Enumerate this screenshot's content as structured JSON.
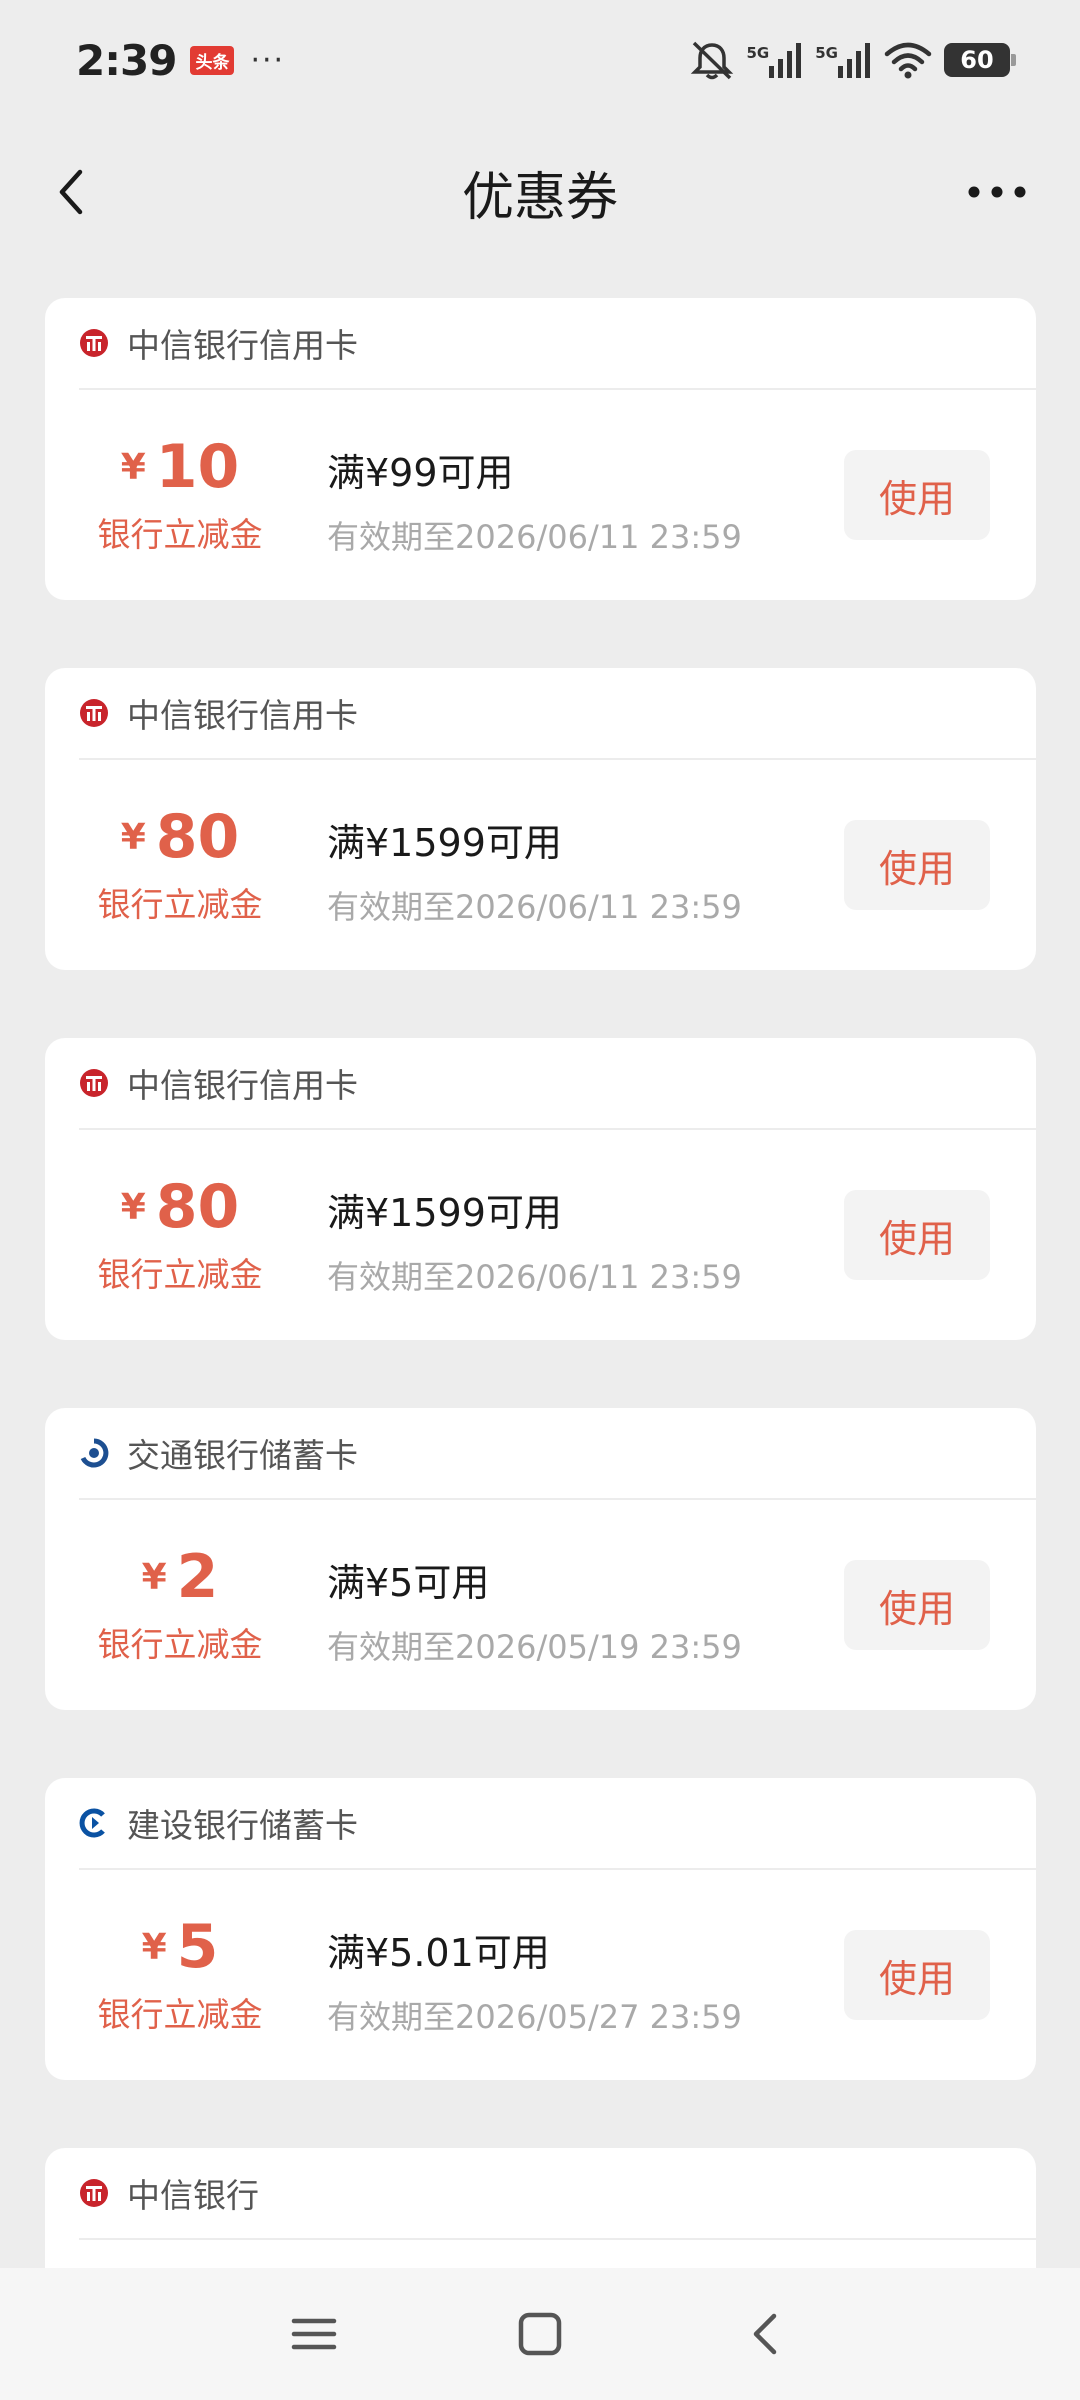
{
  "status_bar": {
    "time": "2:39",
    "app_badge": "头条",
    "more_dots": "···",
    "signal_1_label": "5G",
    "signal_2_label": "5G",
    "battery": "60",
    "icons": [
      "mute-bell-icon",
      "signal-icon",
      "signal-icon",
      "wifi-icon",
      "battery-icon"
    ]
  },
  "header": {
    "title": "优惠券",
    "back_icon": "chevron-left-icon",
    "more_icon": "more-horizontal-icon"
  },
  "coupons": [
    {
      "bank": "中信银行信用卡",
      "logo": "citic",
      "symbol": "¥",
      "amount": "10",
      "type": "银行立减金",
      "condition": "满¥99可用",
      "validity": "有效期至2026/06/11 23:59",
      "button": "使用"
    },
    {
      "bank": "中信银行信用卡",
      "logo": "citic",
      "symbol": "¥",
      "amount": "80",
      "type": "银行立减金",
      "condition": "满¥1599可用",
      "validity": "有效期至2026/06/11 23:59",
      "button": "使用"
    },
    {
      "bank": "中信银行信用卡",
      "logo": "citic",
      "symbol": "¥",
      "amount": "80",
      "type": "银行立减金",
      "condition": "满¥1599可用",
      "validity": "有效期至2026/06/11 23:59",
      "button": "使用"
    },
    {
      "bank": "交通银行储蓄卡",
      "logo": "bocom",
      "symbol": "¥",
      "amount": "2",
      "type": "银行立减金",
      "condition": "满¥5可用",
      "validity": "有效期至2026/05/19 23:59",
      "button": "使用"
    },
    {
      "bank": "建设银行储蓄卡",
      "logo": "ccb",
      "symbol": "¥",
      "amount": "5",
      "type": "银行立减金",
      "condition": "满¥5.01可用",
      "validity": "有效期至2026/05/27 23:59",
      "button": "使用"
    },
    {
      "bank": "中信银行",
      "logo": "citic",
      "partial": true
    }
  ],
  "colors": {
    "accent": "#e0614a",
    "background": "#ededed",
    "card": "#ffffff",
    "citic_red": "#c8242b",
    "bocom_blue": "#1d4f91",
    "ccb_blue": "#0a52a3"
  },
  "nav_bar": {
    "icons": [
      "menu-icon",
      "home-square-icon",
      "back-chevron-icon"
    ]
  }
}
